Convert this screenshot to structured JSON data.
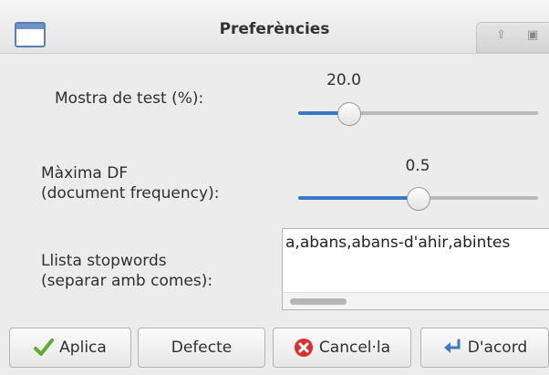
{
  "window": {
    "title": "Preferències"
  },
  "form": {
    "test_sample": {
      "label": "Mostra de test (%):",
      "value": "20.0",
      "fraction": 0.18
    },
    "max_df": {
      "label_line1": "Màxima DF",
      "label_line2": "(document frequency):",
      "value": "0.5",
      "fraction": 0.5
    },
    "stopwords": {
      "label_line1": "Llista stopwords",
      "label_line2": "(separar amb comes):",
      "value": "a,abans,abans-d'ahir,abintes"
    }
  },
  "buttons": {
    "apply": "Aplica",
    "default": "Defecte",
    "cancel": "Cancel·la",
    "ok": "D'acord"
  },
  "icons": {
    "window": "window-icon",
    "apply": "checkmark-icon",
    "cancel": "cancel-icon",
    "ok": "ok-arrow-icon",
    "wm_up": "up-arrow-icon",
    "wm_max": "maximize-icon"
  },
  "colors": {
    "accent": "#3778c8",
    "cancel_red": "#d9302b",
    "apply_green": "#5cae2f"
  }
}
